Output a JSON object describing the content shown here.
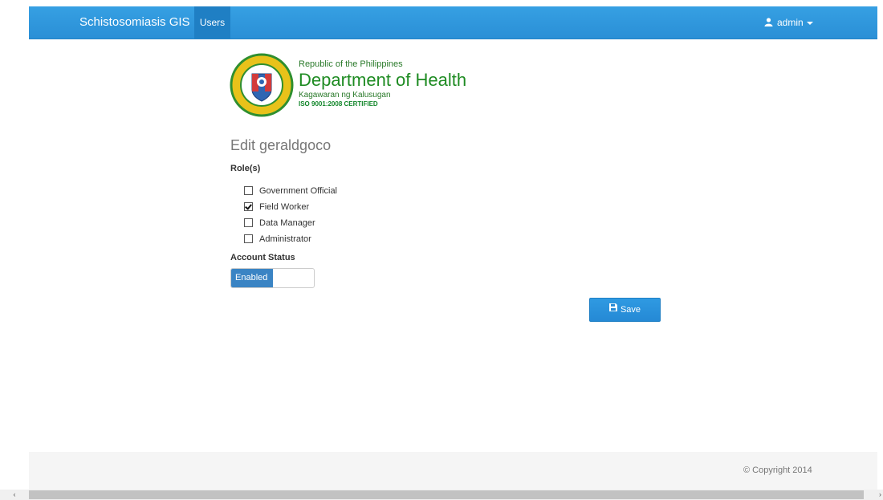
{
  "navbar": {
    "brand": "Schistosomiasis GIS",
    "users_label": "Users",
    "user_label": "admin",
    "background": "#2b90d9"
  },
  "header": {
    "line1": "Republic of the Philippines",
    "line2": "Department of Health",
    "line3": "Kagawaran ng Kalusugan",
    "line4": "ISO 9001:2008 CERTIFIED"
  },
  "form": {
    "title": "Edit geraldgoco",
    "roles_label": "Role(s)",
    "roles": [
      {
        "label": "Government Official",
        "checked": false
      },
      {
        "label": "Field Worker",
        "checked": true
      },
      {
        "label": "Data Manager",
        "checked": false
      },
      {
        "label": "Administrator",
        "checked": false
      }
    ],
    "status_label": "Account Status",
    "status_value": "Enabled",
    "save_label": "Save"
  },
  "footer": {
    "copyright": "© Copyright 2014"
  },
  "scrollbar": {
    "left_arrow": "‹",
    "right_arrow": "›"
  },
  "colors": {
    "accent": "#2b90d9",
    "toggle_on": "#3a84c4",
    "doh_green": "#1e8b22"
  }
}
